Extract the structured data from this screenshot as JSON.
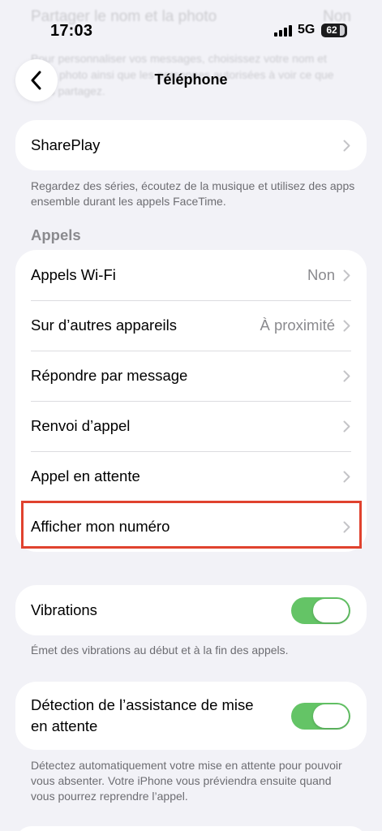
{
  "ghost": {
    "row_label": "Partager le nom et la photo",
    "row_value": "Non",
    "text": "Pour personnaliser vos messages, choisissez votre nom et votre photo ainsi que les personnes autorisées à voir ce que vous partagez."
  },
  "status": {
    "time": "17:03",
    "network": "5G",
    "battery": "62"
  },
  "nav": {
    "title": "Téléphone"
  },
  "shareplay": {
    "label": "SharePlay",
    "footer": "Regardez des séries, écoutez de la musique et utilisez des apps ensemble durant les appels FaceTime."
  },
  "calls": {
    "header": "Appels",
    "items": [
      {
        "label": "Appels Wi-Fi",
        "value": "Non"
      },
      {
        "label": "Sur d’autres appareils",
        "value": "À proximité"
      },
      {
        "label": "Répondre par message",
        "value": ""
      },
      {
        "label": "Renvoi d’appel",
        "value": ""
      },
      {
        "label": "Appel en attente",
        "value": ""
      },
      {
        "label": "Afficher mon numéro",
        "value": ""
      }
    ]
  },
  "vibrations": {
    "label": "Vibrations",
    "on": true,
    "footer": "Émet des vibrations au début et à la fin des appels."
  },
  "hold_assist": {
    "label_line1": "Détection de l’assistance de mise",
    "label_line2": "en attente",
    "on": true,
    "footer": "Détectez automatiquement votre mise en attente pour pouvoir vous absenter. Votre iPhone vous préviendra ensuite quand vous pourrez reprendre l’appel."
  },
  "colors": {
    "toggle_on": "#64c466",
    "highlight": "#e0422e",
    "background": "#f2f2f7"
  },
  "icons": {
    "back": "chevron-left-icon",
    "disclosure": "chevron-right-icon"
  }
}
